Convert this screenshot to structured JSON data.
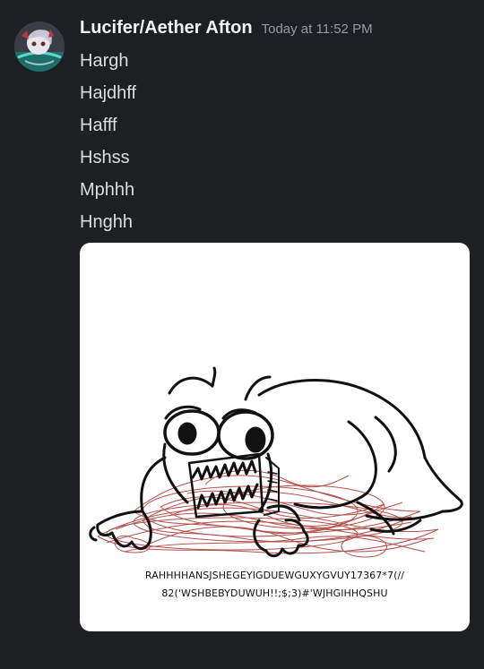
{
  "author": {
    "name": "Lucifer/Aether Afton",
    "timestamp": "Today at 11:52 PM",
    "avatar_icon": "anime-character-avatar"
  },
  "messages": [
    {
      "text": "Hargh"
    },
    {
      "text": "Hajdhff"
    },
    {
      "text": "Hafff"
    },
    {
      "text": "Hshss"
    },
    {
      "text": "Mphhh"
    },
    {
      "text": "Hnghh"
    }
  ],
  "attachment": {
    "caption_lines": [
      "RAHHHHANSJSHEGEYIGDUEWGUXYGVUY17367*7(//",
      "82('WSHBEBYDUWUH!!;$;3)#'WJHGIHHQSHU"
    ],
    "colors": {
      "background": "#ffffff",
      "ink": "#111111",
      "scribble": "#a8322c"
    }
  },
  "theme": {
    "background": "#1e1f23",
    "username": "#f2f3f5",
    "timestamp": "#949ba4",
    "message": "#dbdee1"
  }
}
